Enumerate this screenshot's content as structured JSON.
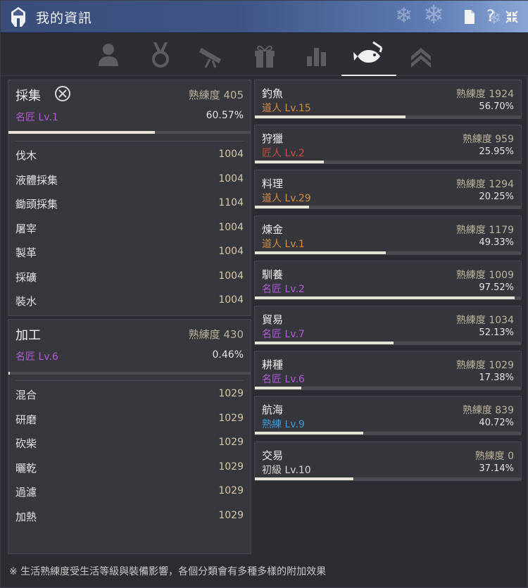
{
  "window": {
    "title": "我的資訊",
    "colors": {
      "accent_purple": "#b45ad6",
      "accent_orange": "#d98b3c",
      "accent_red": "#d2483c",
      "accent_blue": "#3c9ad8",
      "bar_fill": "#e7e2d6"
    }
  },
  "titlebar_buttons": [
    {
      "icon": "document-icon",
      "glyph": "🗎"
    },
    {
      "icon": "help-icon",
      "glyph": "?"
    },
    {
      "icon": "shrink-icon",
      "glyph": "⤡"
    }
  ],
  "tabs": [
    {
      "icon": "profile-icon",
      "active": false
    },
    {
      "icon": "medal-icon",
      "active": false
    },
    {
      "icon": "telescope-icon",
      "active": false
    },
    {
      "icon": "gift-icon",
      "active": false
    },
    {
      "icon": "bar-chart-icon",
      "active": false
    },
    {
      "icon": "fishing-icon",
      "active": true
    },
    {
      "icon": "rank-up-icon",
      "active": false
    }
  ],
  "gathering": {
    "title": "採集",
    "exp": "熟練度 405",
    "level": "名匠 Lv.1",
    "pct": "60.57%",
    "progress": 0.6057,
    "items": [
      {
        "name": "伐木",
        "value": "1004"
      },
      {
        "name": "液體採集",
        "value": "1004"
      },
      {
        "name": "鋤頭採集",
        "value": "1104"
      },
      {
        "name": "屠宰",
        "value": "1004"
      },
      {
        "name": "製革",
        "value": "1004"
      },
      {
        "name": "採礦",
        "value": "1004"
      },
      {
        "name": "裝水",
        "value": "1004"
      }
    ]
  },
  "processing": {
    "title": "加工",
    "exp": "熟練度 430",
    "level": "名匠 Lv.6",
    "pct": "0.46%",
    "progress": 0.0046,
    "items": [
      {
        "name": "混合",
        "value": "1029"
      },
      {
        "name": "研磨",
        "value": "1029"
      },
      {
        "name": "砍柴",
        "value": "1029"
      },
      {
        "name": "曬乾",
        "value": "1029"
      },
      {
        "name": "過濾",
        "value": "1029"
      },
      {
        "name": "加熱",
        "value": "1029"
      }
    ]
  },
  "skills": [
    {
      "name": "釣魚",
      "exp": "熟練度 1924",
      "level": "道人 Lv.15",
      "level_color": "#d98b3c",
      "pct": "56.70%",
      "progress": 0.567
    },
    {
      "name": "狩獵",
      "exp": "熟練度 959",
      "level": "匠人 Lv.2",
      "level_color": "#d2483c",
      "pct": "25.95%",
      "progress": 0.2595
    },
    {
      "name": "料理",
      "exp": "熟練度 1294",
      "level": "道人 Lv.29",
      "level_color": "#d98b3c",
      "pct": "20.25%",
      "progress": 0.2025
    },
    {
      "name": "煉金",
      "exp": "熟練度 1179",
      "level": "道人 Lv.1",
      "level_color": "#d98b3c",
      "pct": "49.33%",
      "progress": 0.4933
    },
    {
      "name": "馴養",
      "exp": "熟練度 1009",
      "level": "名匠 Lv.2",
      "level_color": "#b45ad6",
      "pct": "97.52%",
      "progress": 0.9752
    },
    {
      "name": "貿易",
      "exp": "熟練度 1034",
      "level": "名匠 Lv.7",
      "level_color": "#b45ad6",
      "pct": "52.13%",
      "progress": 0.5213
    },
    {
      "name": "耕種",
      "exp": "熟練度 1029",
      "level": "名匠 Lv.6",
      "level_color": "#b45ad6",
      "pct": "17.38%",
      "progress": 0.1738
    },
    {
      "name": "航海",
      "exp": "熟練度 839",
      "level": "熟練 Lv.9",
      "level_color": "#3c9ad8",
      "pct": "40.72%",
      "progress": 0.4072
    },
    {
      "name": "交易",
      "exp": "熟練度 0",
      "level": "初級 Lv.10",
      "level_color": "#d6d6d6",
      "pct": "37.14%",
      "progress": 0.3714
    }
  ],
  "footer": {
    "note": "※ 生活熟練度受生活等級與裝備影響，各個分類會有多種多樣的附加效果"
  }
}
